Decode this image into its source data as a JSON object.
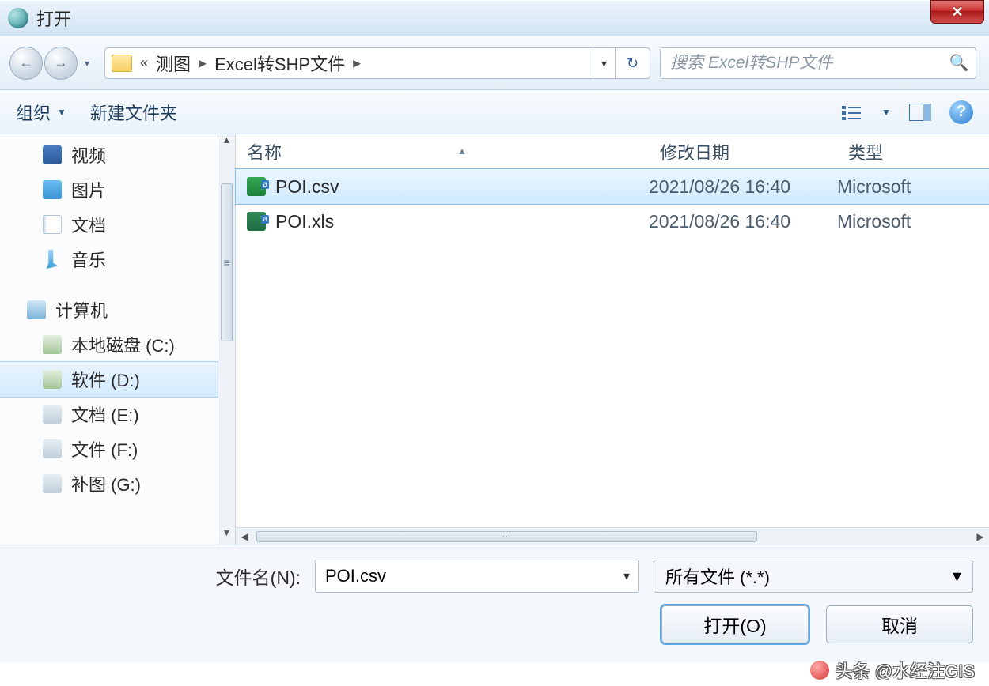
{
  "title": "打开",
  "breadcrumb": {
    "prefix": "«",
    "parent": "测图",
    "current": "Excel转SHP文件"
  },
  "search": {
    "placeholder": "搜索 Excel转SHP文件"
  },
  "toolbar": {
    "organize": "组织",
    "newFolder": "新建文件夹"
  },
  "columns": {
    "name": "名称",
    "modified": "修改日期",
    "type": "类型"
  },
  "sidebar": {
    "items": [
      {
        "label": "视频",
        "icon": "ic-video",
        "level": 1
      },
      {
        "label": "图片",
        "icon": "ic-pic",
        "level": 1
      },
      {
        "label": "文档",
        "icon": "ic-docs",
        "level": 1
      },
      {
        "label": "音乐",
        "icon": "ic-music",
        "level": 1
      },
      {
        "label": "计算机",
        "icon": "ic-comp",
        "level": 0
      },
      {
        "label": "本地磁盘 (C:)",
        "icon": "ic-disk",
        "level": 1
      },
      {
        "label": "软件 (D:)",
        "icon": "ic-disk",
        "level": 1,
        "selected": true
      },
      {
        "label": "文档 (E:)",
        "icon": "ic-hdd",
        "level": 1
      },
      {
        "label": "文件 (F:)",
        "icon": "ic-hdd",
        "level": 1
      },
      {
        "label": "补图 (G:)",
        "icon": "ic-hdd",
        "level": 1
      }
    ]
  },
  "files": [
    {
      "name": "POI.csv",
      "modified": "2021/08/26 16:40",
      "type": "Microsoft",
      "selected": true,
      "icon": "csv"
    },
    {
      "name": "POI.xls",
      "modified": "2021/08/26 16:40",
      "type": "Microsoft",
      "selected": false,
      "icon": "xls"
    }
  ],
  "footer": {
    "fileNameLabel": "文件名(N):",
    "fileNameValue": "POI.csv",
    "filter": "所有文件 (*.*)",
    "open": "打开(O)",
    "cancel": "取消"
  },
  "watermark": "头条 @水经注GIS"
}
